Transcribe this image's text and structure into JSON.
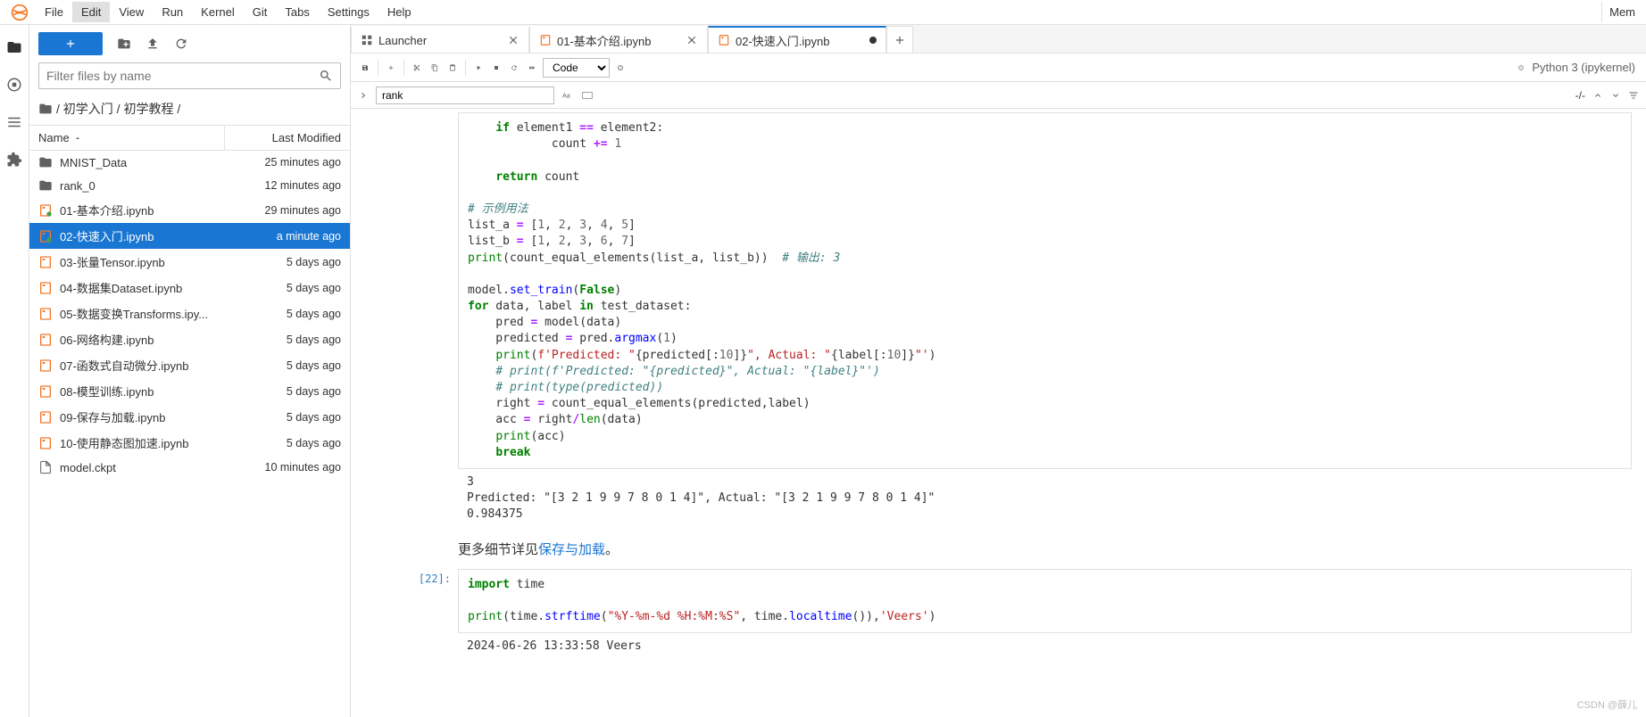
{
  "menubar": {
    "items": [
      "File",
      "Edit",
      "View",
      "Run",
      "Kernel",
      "Git",
      "Tabs",
      "Settings",
      "Help"
    ],
    "active_index": 1,
    "right": "Mem"
  },
  "sidebar": {
    "filter_placeholder": "Filter files by name",
    "breadcrumb": [
      "",
      "初学入门",
      "初学教程",
      ""
    ],
    "header": {
      "name": "Name",
      "modified": "Last Modified"
    },
    "files": [
      {
        "type": "folder",
        "name": "MNIST_Data",
        "mod": "25 minutes ago"
      },
      {
        "type": "folder",
        "name": "rank_0",
        "mod": "12 minutes ago"
      },
      {
        "type": "notebook",
        "running": true,
        "name": "01-基本介绍.ipynb",
        "mod": "29 minutes ago"
      },
      {
        "type": "notebook",
        "running": true,
        "name": "02-快速入门.ipynb",
        "mod": "a minute ago",
        "selected": true
      },
      {
        "type": "notebook",
        "running": false,
        "name": "03-张量Tensor.ipynb",
        "mod": "5 days ago"
      },
      {
        "type": "notebook",
        "running": false,
        "name": "04-数据集Dataset.ipynb",
        "mod": "5 days ago"
      },
      {
        "type": "notebook",
        "running": false,
        "name": "05-数据变换Transforms.ipy...",
        "mod": "5 days ago"
      },
      {
        "type": "notebook",
        "running": false,
        "name": "06-网络构建.ipynb",
        "mod": "5 days ago"
      },
      {
        "type": "notebook",
        "running": false,
        "name": "07-函数式自动微分.ipynb",
        "mod": "5 days ago"
      },
      {
        "type": "notebook",
        "running": false,
        "name": "08-模型训练.ipynb",
        "mod": "5 days ago"
      },
      {
        "type": "notebook",
        "running": false,
        "name": "09-保存与加载.ipynb",
        "mod": "5 days ago"
      },
      {
        "type": "notebook",
        "running": false,
        "name": "10-使用静态图加速.ipynb",
        "mod": "5 days ago"
      },
      {
        "type": "file",
        "name": "model.ckpt",
        "mod": "10 minutes ago"
      }
    ]
  },
  "tabs": [
    {
      "icon": "launcher",
      "label": "Launcher",
      "closeable": true
    },
    {
      "icon": "notebook",
      "label": "01-基本介绍.ipynb",
      "closeable": true
    },
    {
      "icon": "notebook",
      "label": "02-快速入门.ipynb",
      "dirty": true,
      "active": true
    }
  ],
  "nb_toolbar": {
    "cell_type": "Code",
    "kernel": "Python 3 (ipykernel)"
  },
  "nb_search": {
    "value": "rank",
    "replace": "-/-"
  },
  "cells": [
    {
      "type": "code",
      "prompt": "",
      "code_html": "    <span class='kw'>if</span> element1 <span class='op'>==</span> element2:\n            count <span class='op'>+=</span> <span class='num'>1</span>\n\n    <span class='kw'>return</span> count\n\n<span class='com'># 示例用法</span>\nlist_a <span class='op'>=</span> [<span class='num'>1</span>, <span class='num'>2</span>, <span class='num'>3</span>, <span class='num'>4</span>, <span class='num'>5</span>]\nlist_b <span class='op'>=</span> [<span class='num'>1</span>, <span class='num'>2</span>, <span class='num'>3</span>, <span class='num'>6</span>, <span class='num'>7</span>]\n<span class='bi'>print</span>(count_equal_elements(list_a, list_b))  <span class='com'># 输出: 3</span>\n\nmodel.<span class='fn'>set_train</span>(<span class='bool'>False</span>)\n<span class='kw'>for</span> data, label <span class='kw'>in</span> test_dataset:\n    pred <span class='op'>=</span> model(data)\n    predicted <span class='op'>=</span> pred.<span class='fn'>argmax</span>(<span class='num'>1</span>)\n    <span class='bi'>print</span>(<span class='str'>f'Predicted: \"</span>{predicted[:<span class='num'>10</span>]}<span class='str'>\", Actual: \"</span>{label[:<span class='num'>10</span>]}<span class='str'>\"'</span>)\n    <span class='com'># print(f'Predicted: \"{predicted}\", Actual: \"{label}\"')</span>\n    <span class='com'># print(type(predicted))</span>\n    right <span class='op'>=</span> count_equal_elements(predicted,label)\n    acc <span class='op'>=</span> right<span class='op'>/</span><span class='bi'>len</span>(data)\n    <span class='bi'>print</span>(acc)\n    <span class='kw'>break</span>",
      "output": "3\nPredicted: \"[3 2 1 9 9 7 8 0 1 4]\", Actual: \"[3 2 1 9 9 7 8 0 1 4]\"\n0.984375"
    },
    {
      "type": "markdown",
      "html": "更多细节详见<a href='#'>保存与加载</a>。"
    },
    {
      "type": "code",
      "prompt": "[22]:",
      "code_html": "<span class='kw'>import</span> time\n\n<span class='bi'>print</span>(time.<span class='fn'>strftime</span>(<span class='str'>\"%Y-%m-%d %H:%M:%S\"</span>, time.<span class='fn'>localtime</span>()),<span class='str'>'Veers'</span>)",
      "output": "2024-06-26 13:33:58 Veers"
    }
  ],
  "watermark": "CSDN @薛儿"
}
